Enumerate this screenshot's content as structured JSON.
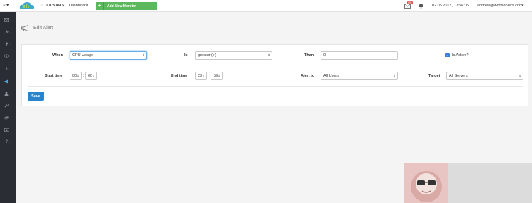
{
  "header": {
    "brand": "CLOUDSTATS",
    "nav_dashboard": "Dashboard",
    "add_monitor_label": "Add New Monitor",
    "add_monitor_plus": "+",
    "menu_toggle": "≡ ▾",
    "mail_badge": "99+",
    "datetime": "02.05.2017, 17:56:05",
    "user_email": "andrew@wooservers.com",
    "user_caret": "▾",
    "colors": {
      "add_button": "#5cb85c",
      "badge": "#d9534f",
      "logo": "#3fa9c9"
    }
  },
  "sidebar": {
    "items": [
      {
        "icon": "envelope-icon"
      },
      {
        "icon": "plug-icon"
      },
      {
        "icon": "pin-icon"
      },
      {
        "icon": "clock-icon"
      },
      {
        "icon": "terminal-icon"
      },
      {
        "icon": "megaphone-icon",
        "active": true
      },
      {
        "icon": "user-icon"
      },
      {
        "icon": "wrench-icon"
      },
      {
        "icon": "gears-icon"
      },
      {
        "icon": "card-icon"
      },
      {
        "icon": "question-icon"
      }
    ],
    "chevron": "›"
  },
  "page": {
    "title": "Edit Alert",
    "icon": "megaphone-icon"
  },
  "form": {
    "when_label": "When",
    "when_value": "CPU Usage",
    "is_label": "Is",
    "is_value": "greater (>)",
    "than_label": "Than",
    "than_value": "0",
    "is_active_label": "Is Active?",
    "is_active_checked": true,
    "start_time_label": "Start time",
    "start_hour": "00",
    "start_min": "00",
    "end_time_label": "End time",
    "end_hour": "23",
    "end_min": "59",
    "time_sep": ":",
    "alert_to_label": "Alert to",
    "alert_to_value": "All Users",
    "target_label": "Target",
    "target_value": "All Servers",
    "save_label": "Save",
    "select_arrow": "⇕"
  }
}
